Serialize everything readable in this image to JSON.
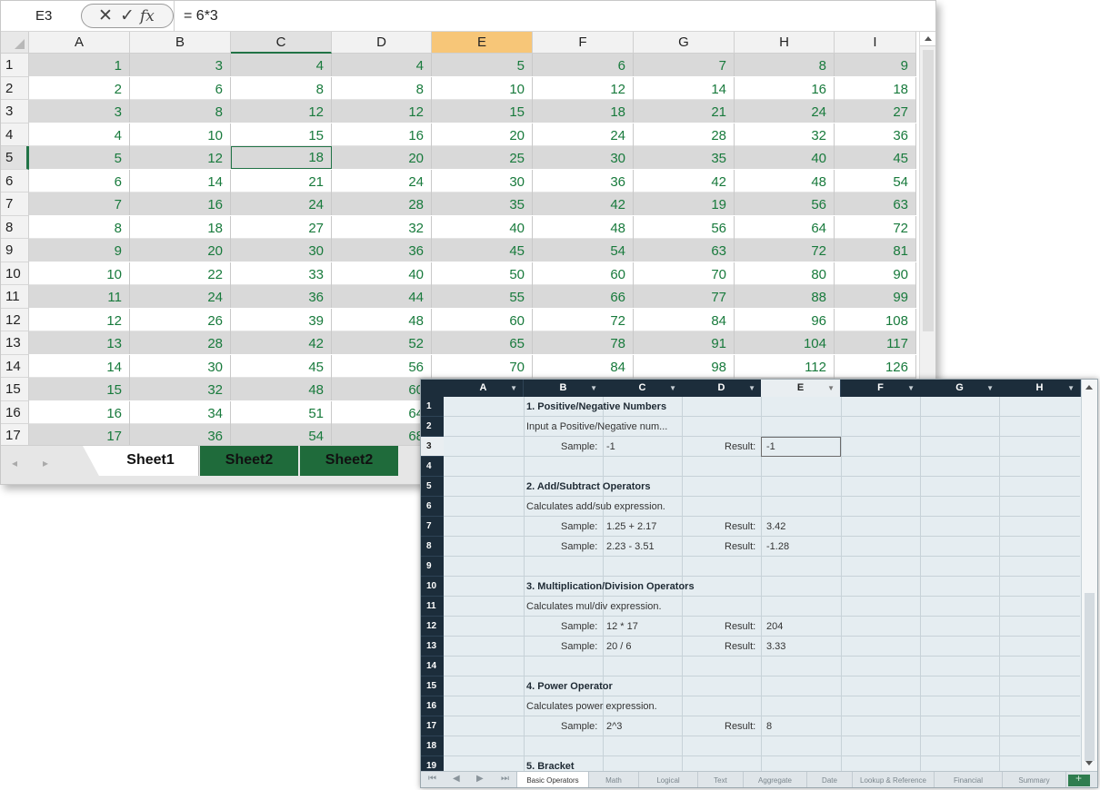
{
  "sheet1_window": {
    "name_box": "E3",
    "cancel_symbol": "✕",
    "enter_symbol": "✓",
    "fx_symbol": "fx",
    "formula": "= 6*3",
    "columns": [
      "A",
      "B",
      "C",
      "D",
      "E",
      "F",
      "G",
      "H",
      "I"
    ],
    "rows": [
      {
        "num": "1",
        "cells": [
          "1",
          "3",
          "4",
          "4",
          "5",
          "6",
          "7",
          "8",
          "9"
        ]
      },
      {
        "num": "2",
        "cells": [
          "2",
          "6",
          "8",
          "8",
          "10",
          "12",
          "14",
          "16",
          "18"
        ]
      },
      {
        "num": "3",
        "cells": [
          "3",
          "8",
          "12",
          "12",
          "15",
          "18",
          "21",
          "24",
          "27"
        ]
      },
      {
        "num": "4",
        "cells": [
          "4",
          "10",
          "15",
          "16",
          "20",
          "24",
          "28",
          "32",
          "36"
        ]
      },
      {
        "num": "5",
        "cells": [
          "5",
          "12",
          "18",
          "20",
          "25",
          "30",
          "35",
          "40",
          "45"
        ]
      },
      {
        "num": "6",
        "cells": [
          "6",
          "14",
          "21",
          "24",
          "30",
          "36",
          "42",
          "48",
          "54"
        ]
      },
      {
        "num": "7",
        "cells": [
          "7",
          "16",
          "24",
          "28",
          "35",
          "42",
          "19",
          "56",
          "63"
        ]
      },
      {
        "num": "8",
        "cells": [
          "8",
          "18",
          "27",
          "32",
          "40",
          "48",
          "56",
          "64",
          "72"
        ]
      },
      {
        "num": "9",
        "cells": [
          "9",
          "20",
          "30",
          "36",
          "45",
          "54",
          "63",
          "72",
          "81"
        ]
      },
      {
        "num": "10",
        "cells": [
          "10",
          "22",
          "33",
          "40",
          "50",
          "60",
          "70",
          "80",
          "90"
        ]
      },
      {
        "num": "11",
        "cells": [
          "11",
          "24",
          "36",
          "44",
          "55",
          "66",
          "77",
          "88",
          "99"
        ]
      },
      {
        "num": "12",
        "cells": [
          "12",
          "26",
          "39",
          "48",
          "60",
          "72",
          "84",
          "96",
          "108"
        ]
      },
      {
        "num": "13",
        "cells": [
          "13",
          "28",
          "42",
          "52",
          "65",
          "78",
          "91",
          "104",
          "117"
        ]
      },
      {
        "num": "14",
        "cells": [
          "14",
          "30",
          "45",
          "56",
          "70",
          "84",
          "98",
          "112",
          "126"
        ]
      },
      {
        "num": "15",
        "cells": [
          "15",
          "32",
          "48",
          "60",
          "",
          "",
          "",
          "",
          ""
        ]
      },
      {
        "num": "16",
        "cells": [
          "16",
          "34",
          "51",
          "64",
          "",
          "",
          "",
          "",
          ""
        ]
      },
      {
        "num": "17",
        "cells": [
          "17",
          "36",
          "54",
          "68",
          "",
          "",
          "",
          "",
          ""
        ]
      }
    ],
    "tabs": [
      "Sheet1",
      "Sheet2",
      "Sheet2"
    ],
    "nav_prev": "◂",
    "nav_next": "▸",
    "colors": {
      "accent": "#217346",
      "cell_text": "#187a3c",
      "active_column": "#f7c678",
      "band": "#d9d9d9"
    }
  },
  "basic_operators_window": {
    "columns": [
      "A",
      "B",
      "C",
      "D",
      "E",
      "F",
      "G",
      "H"
    ],
    "filter_icon": "▼",
    "row_numbers": [
      "1",
      "2",
      "3",
      "4",
      "5",
      "6",
      "7",
      "8",
      "9",
      "10",
      "11",
      "12",
      "13",
      "14",
      "15",
      "16",
      "17",
      "18",
      "19"
    ],
    "sections": {
      "s1_title": "1. Positive/Negative Numbers",
      "s1_desc": "Input a Positive/Negative num...",
      "s1_sample_label": "Sample:",
      "s1_sample_value": "-1",
      "s1_result_label": "Result:",
      "s1_result_value": "-1",
      "s2_title": "2. Add/Subtract Operators",
      "s2_desc": "Calculates add/sub expression.",
      "s2_sample1_label": "Sample:",
      "s2_sample1_value": "1.25 + 2.17",
      "s2_result1_label": "Result:",
      "s2_result1_value": "3.42",
      "s2_sample2_label": "Sample:",
      "s2_sample2_value": "2.23 - 3.51",
      "s2_result2_label": "Result:",
      "s2_result2_value": "-1.28",
      "s3_title": "3. Multiplication/Division Operators",
      "s3_desc": "Calculates mul/div expression.",
      "s3_sample1_label": "Sample:",
      "s3_sample1_value": "12 * 17",
      "s3_result1_label": "Result:",
      "s3_result1_value": "204",
      "s3_sample2_label": "Sample:",
      "s3_sample2_value": "20 / 6",
      "s3_result2_label": "Result:",
      "s3_result2_value": "3.33",
      "s4_title": "4. Power Operator",
      "s4_desc": "Calculates power expression.",
      "s4_sample_label": "Sample:",
      "s4_sample_value": "2^3",
      "s4_result_label": "Result:",
      "s4_result_value": "8",
      "s5_title": "5. Bracket"
    },
    "tabs": [
      "Basic Operators",
      "Math",
      "Logical",
      "Text",
      "Aggregate",
      "Date",
      "Lookup & Reference",
      "Financial",
      "Summary"
    ],
    "nav": [
      "⏮",
      "◀",
      "▶",
      "⏭"
    ],
    "colors": {
      "header": "#1c2d3b",
      "grid": "#e5edf1",
      "add_tab": "#2f7d4f"
    }
  }
}
